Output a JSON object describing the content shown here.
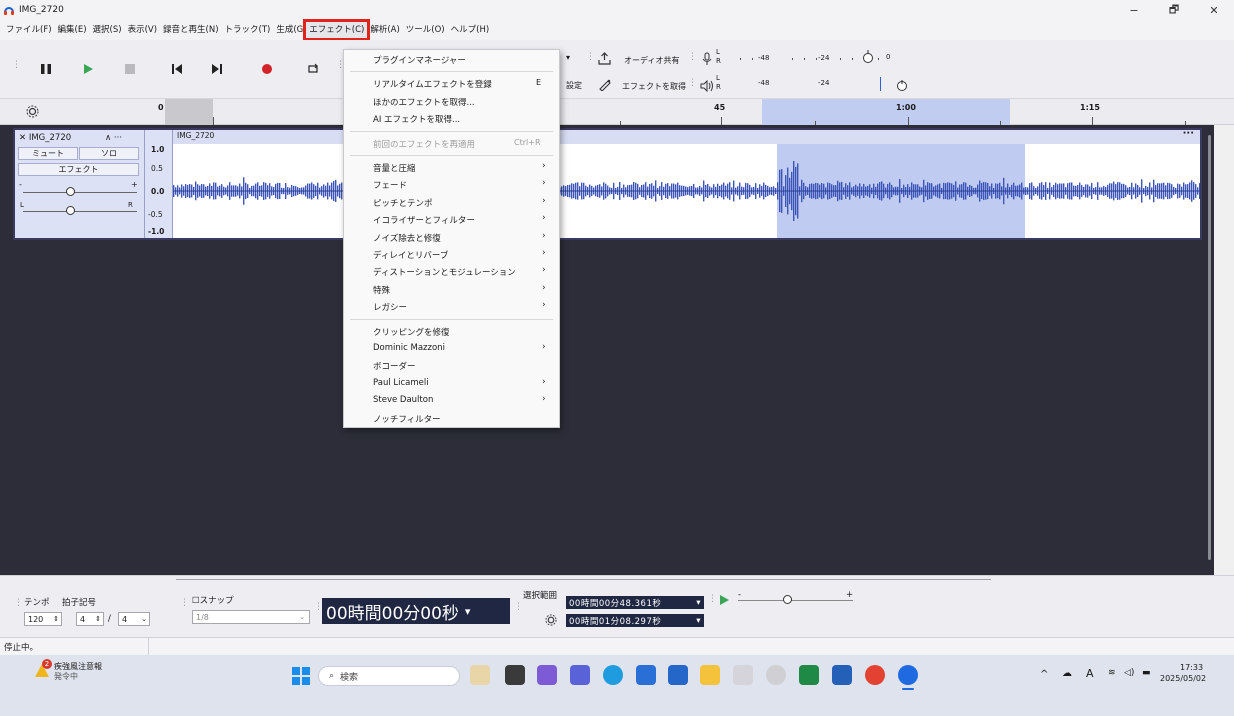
{
  "window": {
    "title": "IMG_2720",
    "minimize": "−",
    "maximize": "🗗",
    "close": "✕"
  },
  "menubar": {
    "items": [
      "ファイル(F)",
      "編集(E)",
      "選択(S)",
      "表示(V)",
      "録音と再生(N)",
      "トラック(T)",
      "生成(G",
      "エフェクト(C)",
      "解析(A)",
      "ツール(O)",
      "ヘルプ(H)"
    ]
  },
  "toolbar": {
    "share_audio": "オーディオ共有",
    "get_effects": "エフェクトを取得",
    "settings_partial": "設定",
    "meter_rec": {
      "l": "L",
      "r": "R",
      "m1": "-48",
      "m2": "-24",
      "m3": "0"
    },
    "meter_play": {
      "l": "L",
      "r": "R",
      "m1": "-48",
      "m2": "-24"
    }
  },
  "ruler": {
    "ticks": [
      "0",
      "45",
      "1:00",
      "1:15"
    ]
  },
  "track": {
    "name": "IMG_2720",
    "menu": "∧ ···",
    "mute": "ミュート",
    "solo": "ソロ",
    "effects": "エフェクト",
    "gain_minus": "-",
    "gain_plus": "+",
    "pan_l": "L",
    "pan_r": "R",
    "scale": [
      "1.0",
      "0.5",
      "0.0",
      "-0.5",
      "-1.0"
    ],
    "clip_title": "IMG_2720",
    "clip_menu": "···"
  },
  "effect_menu": {
    "items": [
      {
        "label": "プラグインマネージャー",
        "shortcut": "",
        "sub": false,
        "disabled": false
      },
      {
        "sep": true
      },
      {
        "label": "リアルタイムエフェクトを登録",
        "shortcut": "E",
        "sub": false,
        "disabled": false
      },
      {
        "label": "ほかのエフェクトを取得...",
        "shortcut": "",
        "sub": false,
        "disabled": false
      },
      {
        "label": "AI エフェクトを取得...",
        "shortcut": "",
        "sub": false,
        "disabled": false
      },
      {
        "sep": true
      },
      {
        "label": "前回のエフェクトを再適用",
        "shortcut": "Ctrl+R",
        "sub": false,
        "disabled": true
      },
      {
        "sep": true
      },
      {
        "label": "音量と圧縮",
        "shortcut": "",
        "sub": true,
        "disabled": false
      },
      {
        "label": "フェード",
        "shortcut": "",
        "sub": true,
        "disabled": false
      },
      {
        "label": "ピッチとテンポ",
        "shortcut": "",
        "sub": true,
        "disabled": false
      },
      {
        "label": "イコライザーとフィルター",
        "shortcut": "",
        "sub": true,
        "disabled": false
      },
      {
        "label": "ノイズ除去と修復",
        "shortcut": "",
        "sub": true,
        "disabled": false
      },
      {
        "label": "ディレイとリバーブ",
        "shortcut": "",
        "sub": true,
        "disabled": false
      },
      {
        "label": "ディストーションとモジュレーション",
        "shortcut": "",
        "sub": true,
        "disabled": false
      },
      {
        "label": "特殊",
        "shortcut": "",
        "sub": true,
        "disabled": false
      },
      {
        "label": "レガシー",
        "shortcut": "",
        "sub": true,
        "disabled": false
      },
      {
        "sep": true
      },
      {
        "label": "クリッピングを修復",
        "shortcut": "",
        "sub": false,
        "disabled": false
      },
      {
        "label": "Dominic Mazzoni",
        "shortcut": "",
        "sub": true,
        "disabled": false
      },
      {
        "label": "ボコーダー",
        "shortcut": "",
        "sub": false,
        "disabled": false
      },
      {
        "label": "Paul Licameli",
        "shortcut": "",
        "sub": true,
        "disabled": false
      },
      {
        "label": "Steve Daulton",
        "shortcut": "",
        "sub": true,
        "disabled": false
      },
      {
        "label": "ノッチフィルター",
        "shortcut": "",
        "sub": false,
        "disabled": false
      }
    ],
    "arrow": "›"
  },
  "bottom": {
    "tempo_label": "テンポ",
    "timesig_label": "拍子記号",
    "tempo_value": "120",
    "sig_num": "4",
    "sig_slash": "/",
    "sig_den": "4",
    "snap_label": "スナップ",
    "snap_value": "1/8",
    "time_display": "00時間00分00秒",
    "selection_label": "選択範囲",
    "sel_start": "00時間00分48.361秒",
    "sel_end": "00時間01分08.297秒",
    "speed_minus": "-",
    "speed_plus": "+"
  },
  "status": {
    "text": "停止中。"
  },
  "taskbar": {
    "weather_title": "疾強風注意報",
    "weather_sub": "発令中",
    "weather_badge": "2",
    "search_placeholder": "検索",
    "time": "17:33",
    "date": "2025/05/02",
    "ime": "A"
  },
  "colors": {
    "highlight_red": "#e0241b",
    "selection": "#bfcbf0",
    "waveform": "#3d55b8",
    "track_bg": "#2c2d38",
    "time_display_bg": "#1f2742"
  }
}
